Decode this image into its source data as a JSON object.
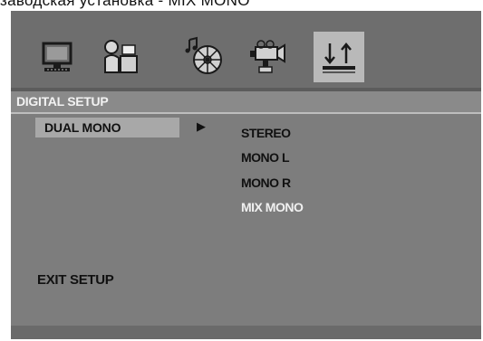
{
  "caption": "заводская установка - MIX MONO",
  "toolbar": {
    "icons": [
      {
        "name": "monitor-icon",
        "selected": false
      },
      {
        "name": "language-icon",
        "selected": false
      },
      {
        "name": "audio-disc-icon",
        "selected": false
      },
      {
        "name": "camera-icon",
        "selected": false
      },
      {
        "name": "digital-setup-icon",
        "selected": true
      }
    ]
  },
  "menu": {
    "title": "DIGITAL SETUP",
    "item_label": "DUAL MONO",
    "arrow": "▶",
    "options": [
      "STEREO",
      "MONO L",
      "MONO R",
      "MIX MONO"
    ],
    "active_option": "MIX MONO"
  },
  "exit_label": "EXIT  SETUP",
  "colors": {
    "background": "#7d7d7d",
    "highlight": "#a8a8a8",
    "selected_icon": "#b9b9b9",
    "active_text": "#f0f0f0"
  }
}
